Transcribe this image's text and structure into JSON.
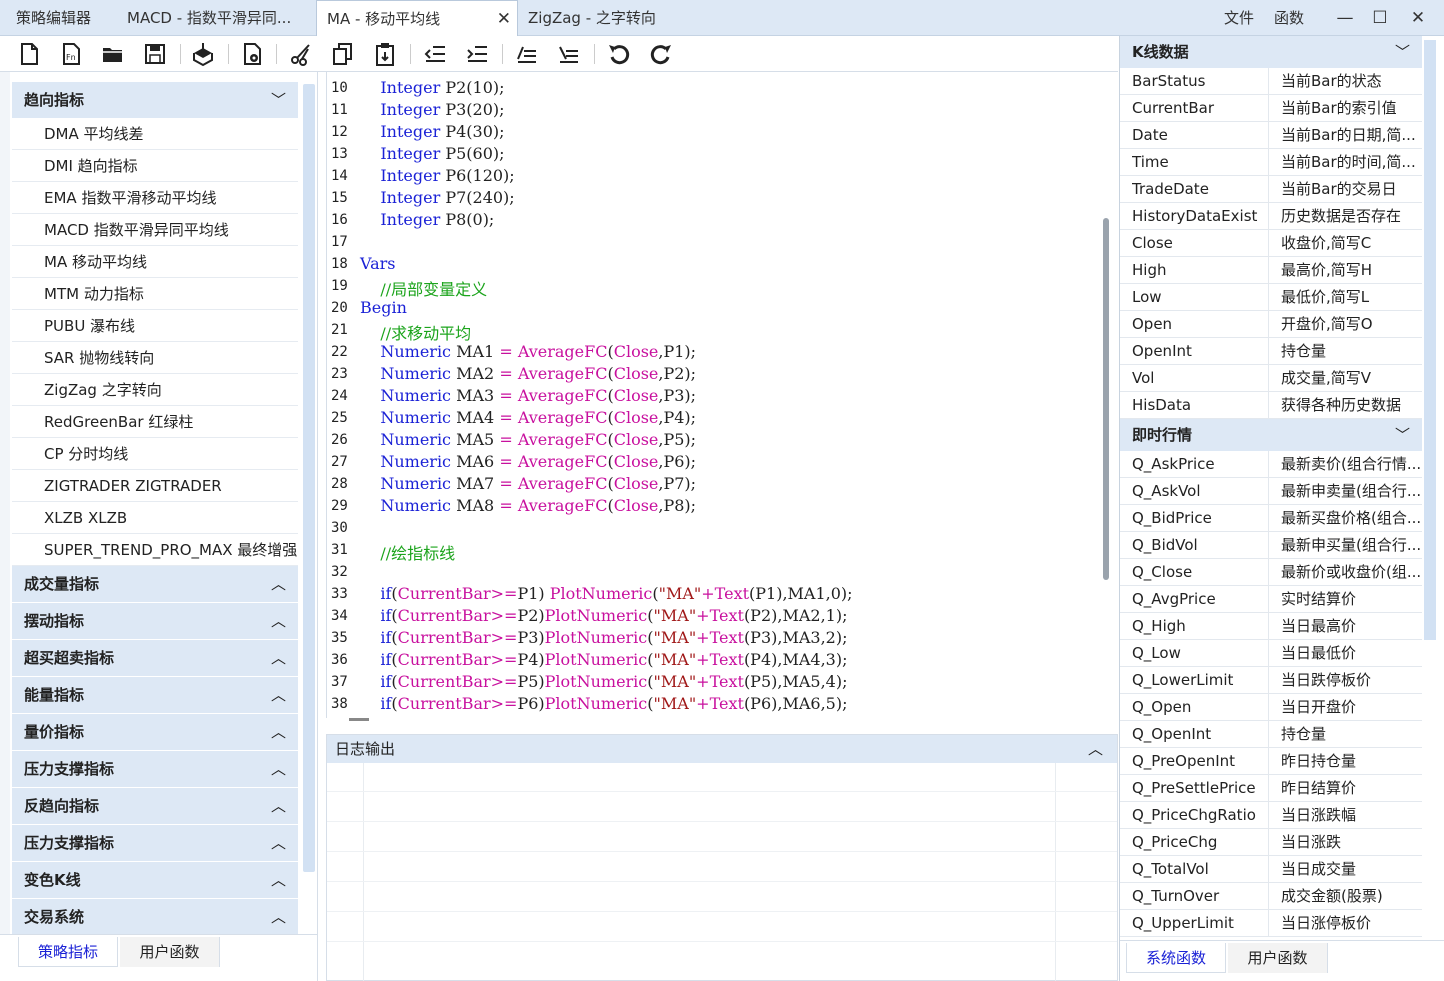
{
  "tabs": [
    {
      "label": "策略编辑器"
    },
    {
      "label": "MACD - 指数平滑异同..."
    },
    {
      "label": "MA - 移动平均线"
    },
    {
      "label": "ZigZag - 之字转向"
    }
  ],
  "menu": {
    "file": "文件",
    "func": "函数"
  },
  "left": {
    "groups": [
      {
        "label": "趋向指标",
        "chev": "⌄"
      },
      {
        "label": "成交量指标",
        "chev": "⌃"
      },
      {
        "label": "摆动指标",
        "chev": "⌃"
      },
      {
        "label": "超买超卖指标",
        "chev": "⌃"
      },
      {
        "label": "能量指标",
        "chev": "⌃"
      },
      {
        "label": "量价指标",
        "chev": "⌃"
      },
      {
        "label": "压力支撑指标",
        "chev": "⌃"
      },
      {
        "label": "反趋向指标",
        "chev": "⌃"
      },
      {
        "label": "压力支撑指标",
        "chev": "⌃"
      },
      {
        "label": "变色K线",
        "chev": "⌃"
      },
      {
        "label": "交易系统",
        "chev": "⌃"
      }
    ],
    "items": [
      "DMA  平均线差",
      "DMI  趋向指标",
      "EMA  指数平滑移动平均线",
      "MACD  指数平滑异同平均线",
      "MA  移动平均线",
      "MTM  动力指标",
      "PUBU  瀑布线",
      "SAR  抛物线转向",
      "ZigZag  之字转向",
      "RedGreenBar  红绿柱",
      "CP  分时均线",
      "ZIGTRADER  ZIGTRADER",
      "XLZB  XLZB",
      "SUPER_TREND_PRO_MAX  最终增强"
    ],
    "bottom_tabs": [
      "策略指标",
      "用户函数"
    ]
  },
  "code": {
    "lines": [
      {
        "n": "10",
        "t": [
          [
            "    ",
            ""
          ],
          [
            "Integer",
            "kw"
          ],
          [
            " P2(10);",
            ""
          ]
        ]
      },
      {
        "n": "11",
        "t": [
          [
            "    ",
            ""
          ],
          [
            "Integer",
            "kw"
          ],
          [
            " P3(20);",
            ""
          ]
        ]
      },
      {
        "n": "12",
        "t": [
          [
            "    ",
            ""
          ],
          [
            "Integer",
            "kw"
          ],
          [
            " P4(30);",
            ""
          ]
        ]
      },
      {
        "n": "13",
        "t": [
          [
            "    ",
            ""
          ],
          [
            "Integer",
            "kw"
          ],
          [
            " P5(60);",
            ""
          ]
        ]
      },
      {
        "n": "14",
        "t": [
          [
            "    ",
            ""
          ],
          [
            "Integer",
            "kw"
          ],
          [
            " P6(120);",
            ""
          ]
        ]
      },
      {
        "n": "15",
        "t": [
          [
            "    ",
            ""
          ],
          [
            "Integer",
            "kw"
          ],
          [
            " P7(240);",
            ""
          ]
        ]
      },
      {
        "n": "16",
        "t": [
          [
            "    ",
            ""
          ],
          [
            "Integer",
            "kw"
          ],
          [
            " P8(0);",
            ""
          ]
        ]
      },
      {
        "n": "17",
        "t": []
      },
      {
        "n": "18",
        "t": [
          [
            "Vars",
            "kw"
          ]
        ]
      },
      {
        "n": "19",
        "t": [
          [
            "    ",
            ""
          ],
          [
            "//局部变量定义",
            "cm"
          ]
        ]
      },
      {
        "n": "20",
        "t": [
          [
            "Begin",
            "kw"
          ]
        ]
      },
      {
        "n": "21",
        "t": [
          [
            "    ",
            ""
          ],
          [
            "//求移动平均",
            "cm"
          ]
        ]
      },
      {
        "n": "22",
        "t": [
          [
            "    ",
            ""
          ],
          [
            "Numeric",
            "kw"
          ],
          [
            " MA1 ",
            ""
          ],
          [
            "=",
            "fn"
          ],
          [
            " ",
            ""
          ],
          [
            "AverageFC",
            "fn"
          ],
          [
            "(",
            ""
          ],
          [
            "Close",
            "fn"
          ],
          [
            ",P1);",
            ""
          ]
        ]
      },
      {
        "n": "23",
        "t": [
          [
            "    ",
            ""
          ],
          [
            "Numeric",
            "kw"
          ],
          [
            " MA2 ",
            ""
          ],
          [
            "=",
            "fn"
          ],
          [
            " ",
            ""
          ],
          [
            "AverageFC",
            "fn"
          ],
          [
            "(",
            ""
          ],
          [
            "Close",
            "fn"
          ],
          [
            ",P2);",
            ""
          ]
        ]
      },
      {
        "n": "24",
        "t": [
          [
            "    ",
            ""
          ],
          [
            "Numeric",
            "kw"
          ],
          [
            " MA3 ",
            ""
          ],
          [
            "=",
            "fn"
          ],
          [
            " ",
            ""
          ],
          [
            "AverageFC",
            "fn"
          ],
          [
            "(",
            ""
          ],
          [
            "Close",
            "fn"
          ],
          [
            ",P3);",
            ""
          ]
        ]
      },
      {
        "n": "25",
        "t": [
          [
            "    ",
            ""
          ],
          [
            "Numeric",
            "kw"
          ],
          [
            " MA4 ",
            ""
          ],
          [
            "=",
            "fn"
          ],
          [
            " ",
            ""
          ],
          [
            "AverageFC",
            "fn"
          ],
          [
            "(",
            ""
          ],
          [
            "Close",
            "fn"
          ],
          [
            ",P4);",
            ""
          ]
        ]
      },
      {
        "n": "26",
        "t": [
          [
            "    ",
            ""
          ],
          [
            "Numeric",
            "kw"
          ],
          [
            " MA5 ",
            ""
          ],
          [
            "=",
            "fn"
          ],
          [
            " ",
            ""
          ],
          [
            "AverageFC",
            "fn"
          ],
          [
            "(",
            ""
          ],
          [
            "Close",
            "fn"
          ],
          [
            ",P5);",
            ""
          ]
        ]
      },
      {
        "n": "27",
        "t": [
          [
            "    ",
            ""
          ],
          [
            "Numeric",
            "kw"
          ],
          [
            " MA6 ",
            ""
          ],
          [
            "=",
            "fn"
          ],
          [
            " ",
            ""
          ],
          [
            "AverageFC",
            "fn"
          ],
          [
            "(",
            ""
          ],
          [
            "Close",
            "fn"
          ],
          [
            ",P6);",
            ""
          ]
        ]
      },
      {
        "n": "28",
        "t": [
          [
            "    ",
            ""
          ],
          [
            "Numeric",
            "kw"
          ],
          [
            " MA7 ",
            ""
          ],
          [
            "=",
            "fn"
          ],
          [
            " ",
            ""
          ],
          [
            "AverageFC",
            "fn"
          ],
          [
            "(",
            ""
          ],
          [
            "Close",
            "fn"
          ],
          [
            ",P7);",
            ""
          ]
        ]
      },
      {
        "n": "29",
        "t": [
          [
            "    ",
            ""
          ],
          [
            "Numeric",
            "kw"
          ],
          [
            " MA8 ",
            ""
          ],
          [
            "=",
            "fn"
          ],
          [
            " ",
            ""
          ],
          [
            "AverageFC",
            "fn"
          ],
          [
            "(",
            ""
          ],
          [
            "Close",
            "fn"
          ],
          [
            ",P8);",
            ""
          ]
        ]
      },
      {
        "n": "30",
        "t": []
      },
      {
        "n": "31",
        "t": [
          [
            "    ",
            ""
          ],
          [
            "//绘指标线",
            "cm"
          ]
        ]
      },
      {
        "n": "32",
        "t": []
      },
      {
        "n": "33",
        "t": [
          [
            "    ",
            ""
          ],
          [
            "if",
            "kw"
          ],
          [
            "(",
            ""
          ],
          [
            "CurrentBar",
            "fn"
          ],
          [
            ">=",
            "fn"
          ],
          [
            "P1) ",
            ""
          ],
          [
            "PlotNumeric",
            "fn"
          ],
          [
            "(",
            ""
          ],
          [
            "\"MA\"",
            "st"
          ],
          [
            "+",
            "fn"
          ],
          [
            "Text",
            "fn"
          ],
          [
            "(P1),MA1,0);",
            ""
          ]
        ]
      },
      {
        "n": "34",
        "t": [
          [
            "    ",
            ""
          ],
          [
            "if",
            "kw"
          ],
          [
            "(",
            ""
          ],
          [
            "CurrentBar",
            "fn"
          ],
          [
            ">=",
            "fn"
          ],
          [
            "P2)",
            ""
          ],
          [
            "PlotNumeric",
            "fn"
          ],
          [
            "(",
            ""
          ],
          [
            "\"MA\"",
            "st"
          ],
          [
            "+",
            "fn"
          ],
          [
            "Text",
            "fn"
          ],
          [
            "(P2),MA2,1);",
            ""
          ]
        ]
      },
      {
        "n": "35",
        "t": [
          [
            "    ",
            ""
          ],
          [
            "if",
            "kw"
          ],
          [
            "(",
            ""
          ],
          [
            "CurrentBar",
            "fn"
          ],
          [
            ">=",
            "fn"
          ],
          [
            "P3)",
            ""
          ],
          [
            "PlotNumeric",
            "fn"
          ],
          [
            "(",
            ""
          ],
          [
            "\"MA\"",
            "st"
          ],
          [
            "+",
            "fn"
          ],
          [
            "Text",
            "fn"
          ],
          [
            "(P3),MA3,2);",
            ""
          ]
        ]
      },
      {
        "n": "36",
        "t": [
          [
            "    ",
            ""
          ],
          [
            "if",
            "kw"
          ],
          [
            "(",
            ""
          ],
          [
            "CurrentBar",
            "fn"
          ],
          [
            ">=",
            "fn"
          ],
          [
            "P4)",
            ""
          ],
          [
            "PlotNumeric",
            "fn"
          ],
          [
            "(",
            ""
          ],
          [
            "\"MA\"",
            "st"
          ],
          [
            "+",
            "fn"
          ],
          [
            "Text",
            "fn"
          ],
          [
            "(P4),MA4,3);",
            ""
          ]
        ]
      },
      {
        "n": "37",
        "t": [
          [
            "    ",
            ""
          ],
          [
            "if",
            "kw"
          ],
          [
            "(",
            ""
          ],
          [
            "CurrentBar",
            "fn"
          ],
          [
            ">=",
            "fn"
          ],
          [
            "P5)",
            ""
          ],
          [
            "PlotNumeric",
            "fn"
          ],
          [
            "(",
            ""
          ],
          [
            "\"MA\"",
            "st"
          ],
          [
            "+",
            "fn"
          ],
          [
            "Text",
            "fn"
          ],
          [
            "(P5),MA5,4);",
            ""
          ]
        ]
      },
      {
        "n": "38",
        "t": [
          [
            "    ",
            ""
          ],
          [
            "if",
            "kw"
          ],
          [
            "(",
            ""
          ],
          [
            "CurrentBar",
            "fn"
          ],
          [
            ">=",
            "fn"
          ],
          [
            "P6)",
            ""
          ],
          [
            "PlotNumeric",
            "fn"
          ],
          [
            "(",
            ""
          ],
          [
            "\"MA\"",
            "st"
          ],
          [
            "+",
            "fn"
          ],
          [
            "Text",
            "fn"
          ],
          [
            "(P6),MA6,5);",
            ""
          ]
        ]
      }
    ]
  },
  "log": {
    "title": "日志输出"
  },
  "right": {
    "group1": "K线数据",
    "rows1": [
      [
        "BarStatus",
        "当前Bar的状态"
      ],
      [
        "CurrentBar",
        "当前Bar的索引值"
      ],
      [
        "Date",
        "当前Bar的日期,简..."
      ],
      [
        "Time",
        "当前Bar的时间,简..."
      ],
      [
        "TradeDate",
        "当前Bar的交易日"
      ],
      [
        "HistoryDataExist",
        "历史数据是否存在"
      ],
      [
        "Close",
        "收盘价,简写C"
      ],
      [
        "High",
        "最高价,简写H"
      ],
      [
        "Low",
        "最低价,简写L"
      ],
      [
        "Open",
        "开盘价,简写O"
      ],
      [
        "OpenInt",
        "持仓量"
      ],
      [
        "Vol",
        "成交量,简写V"
      ],
      [
        "HisData",
        "获得各种历史数据"
      ]
    ],
    "group2": "即时行情",
    "rows2": [
      [
        "Q_AskPrice",
        "最新卖价(组合行情..."
      ],
      [
        "Q_AskVol",
        "最新申卖量(组合行..."
      ],
      [
        "Q_BidPrice",
        "最新买盘价格(组合..."
      ],
      [
        "Q_BidVol",
        "最新申买量(组合行..."
      ],
      [
        "Q_Close",
        "最新价或收盘价(组..."
      ],
      [
        "Q_AvgPrice",
        "实时结算价"
      ],
      [
        "Q_High",
        "当日最高价"
      ],
      [
        "Q_Low",
        "当日最低价"
      ],
      [
        "Q_LowerLimit",
        "当日跌停板价"
      ],
      [
        "Q_Open",
        "当日开盘价"
      ],
      [
        "Q_OpenInt",
        "持仓量"
      ],
      [
        "Q_PreOpenInt",
        "昨日持仓量"
      ],
      [
        "Q_PreSettlePrice",
        "昨日结算价"
      ],
      [
        "Q_PriceChgRatio",
        "当日涨跌幅"
      ],
      [
        "Q_PriceChg",
        "当日涨跌"
      ],
      [
        "Q_TotalVol",
        "当日成交量"
      ],
      [
        "Q_TurnOver",
        "成交金额(股票)"
      ],
      [
        "Q_UpperLimit",
        "当日涨停板价"
      ]
    ],
    "bottom_tabs": [
      "系统函数",
      "用户函数"
    ]
  },
  "colors": {
    "accent": "#1b22d6",
    "comment": "#1ca41c",
    "function": "#c8109e",
    "panel_header": "#dde8f5"
  }
}
